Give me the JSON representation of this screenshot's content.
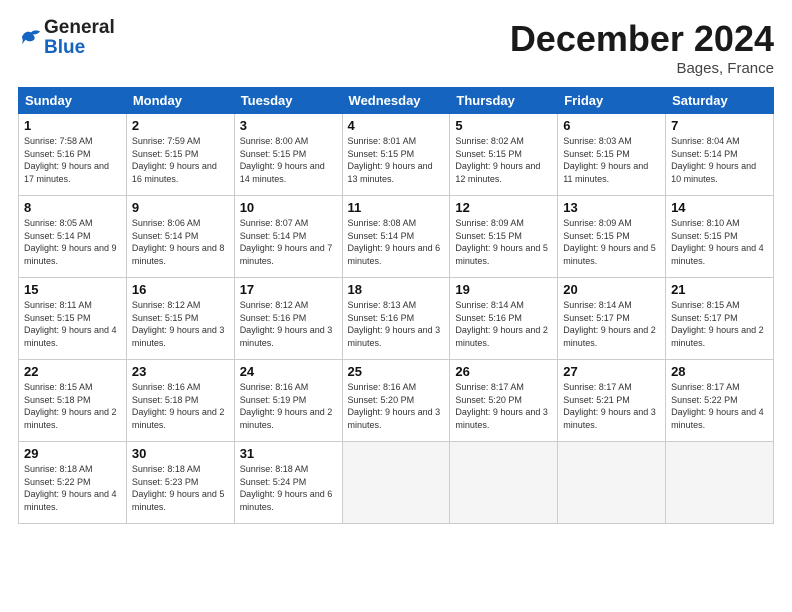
{
  "header": {
    "logo_general": "General",
    "logo_blue": "Blue",
    "month_title": "December 2024",
    "location": "Bages, France"
  },
  "days_of_week": [
    "Sunday",
    "Monday",
    "Tuesday",
    "Wednesday",
    "Thursday",
    "Friday",
    "Saturday"
  ],
  "weeks": [
    [
      {
        "day": "1",
        "info": "Sunrise: 7:58 AM\nSunset: 5:16 PM\nDaylight: 9 hours and 17 minutes."
      },
      {
        "day": "2",
        "info": "Sunrise: 7:59 AM\nSunset: 5:15 PM\nDaylight: 9 hours and 16 minutes."
      },
      {
        "day": "3",
        "info": "Sunrise: 8:00 AM\nSunset: 5:15 PM\nDaylight: 9 hours and 14 minutes."
      },
      {
        "day": "4",
        "info": "Sunrise: 8:01 AM\nSunset: 5:15 PM\nDaylight: 9 hours and 13 minutes."
      },
      {
        "day": "5",
        "info": "Sunrise: 8:02 AM\nSunset: 5:15 PM\nDaylight: 9 hours and 12 minutes."
      },
      {
        "day": "6",
        "info": "Sunrise: 8:03 AM\nSunset: 5:15 PM\nDaylight: 9 hours and 11 minutes."
      },
      {
        "day": "7",
        "info": "Sunrise: 8:04 AM\nSunset: 5:14 PM\nDaylight: 9 hours and 10 minutes."
      }
    ],
    [
      {
        "day": "8",
        "info": "Sunrise: 8:05 AM\nSunset: 5:14 PM\nDaylight: 9 hours and 9 minutes."
      },
      {
        "day": "9",
        "info": "Sunrise: 8:06 AM\nSunset: 5:14 PM\nDaylight: 9 hours and 8 minutes."
      },
      {
        "day": "10",
        "info": "Sunrise: 8:07 AM\nSunset: 5:14 PM\nDaylight: 9 hours and 7 minutes."
      },
      {
        "day": "11",
        "info": "Sunrise: 8:08 AM\nSunset: 5:14 PM\nDaylight: 9 hours and 6 minutes."
      },
      {
        "day": "12",
        "info": "Sunrise: 8:09 AM\nSunset: 5:15 PM\nDaylight: 9 hours and 5 minutes."
      },
      {
        "day": "13",
        "info": "Sunrise: 8:09 AM\nSunset: 5:15 PM\nDaylight: 9 hours and 5 minutes."
      },
      {
        "day": "14",
        "info": "Sunrise: 8:10 AM\nSunset: 5:15 PM\nDaylight: 9 hours and 4 minutes."
      }
    ],
    [
      {
        "day": "15",
        "info": "Sunrise: 8:11 AM\nSunset: 5:15 PM\nDaylight: 9 hours and 4 minutes."
      },
      {
        "day": "16",
        "info": "Sunrise: 8:12 AM\nSunset: 5:15 PM\nDaylight: 9 hours and 3 minutes."
      },
      {
        "day": "17",
        "info": "Sunrise: 8:12 AM\nSunset: 5:16 PM\nDaylight: 9 hours and 3 minutes."
      },
      {
        "day": "18",
        "info": "Sunrise: 8:13 AM\nSunset: 5:16 PM\nDaylight: 9 hours and 3 minutes."
      },
      {
        "day": "19",
        "info": "Sunrise: 8:14 AM\nSunset: 5:16 PM\nDaylight: 9 hours and 2 minutes."
      },
      {
        "day": "20",
        "info": "Sunrise: 8:14 AM\nSunset: 5:17 PM\nDaylight: 9 hours and 2 minutes."
      },
      {
        "day": "21",
        "info": "Sunrise: 8:15 AM\nSunset: 5:17 PM\nDaylight: 9 hours and 2 minutes."
      }
    ],
    [
      {
        "day": "22",
        "info": "Sunrise: 8:15 AM\nSunset: 5:18 PM\nDaylight: 9 hours and 2 minutes."
      },
      {
        "day": "23",
        "info": "Sunrise: 8:16 AM\nSunset: 5:18 PM\nDaylight: 9 hours and 2 minutes."
      },
      {
        "day": "24",
        "info": "Sunrise: 8:16 AM\nSunset: 5:19 PM\nDaylight: 9 hours and 2 minutes."
      },
      {
        "day": "25",
        "info": "Sunrise: 8:16 AM\nSunset: 5:20 PM\nDaylight: 9 hours and 3 minutes."
      },
      {
        "day": "26",
        "info": "Sunrise: 8:17 AM\nSunset: 5:20 PM\nDaylight: 9 hours and 3 minutes."
      },
      {
        "day": "27",
        "info": "Sunrise: 8:17 AM\nSunset: 5:21 PM\nDaylight: 9 hours and 3 minutes."
      },
      {
        "day": "28",
        "info": "Sunrise: 8:17 AM\nSunset: 5:22 PM\nDaylight: 9 hours and 4 minutes."
      }
    ],
    [
      {
        "day": "29",
        "info": "Sunrise: 8:18 AM\nSunset: 5:22 PM\nDaylight: 9 hours and 4 minutes."
      },
      {
        "day": "30",
        "info": "Sunrise: 8:18 AM\nSunset: 5:23 PM\nDaylight: 9 hours and 5 minutes."
      },
      {
        "day": "31",
        "info": "Sunrise: 8:18 AM\nSunset: 5:24 PM\nDaylight: 9 hours and 6 minutes."
      },
      null,
      null,
      null,
      null
    ]
  ]
}
